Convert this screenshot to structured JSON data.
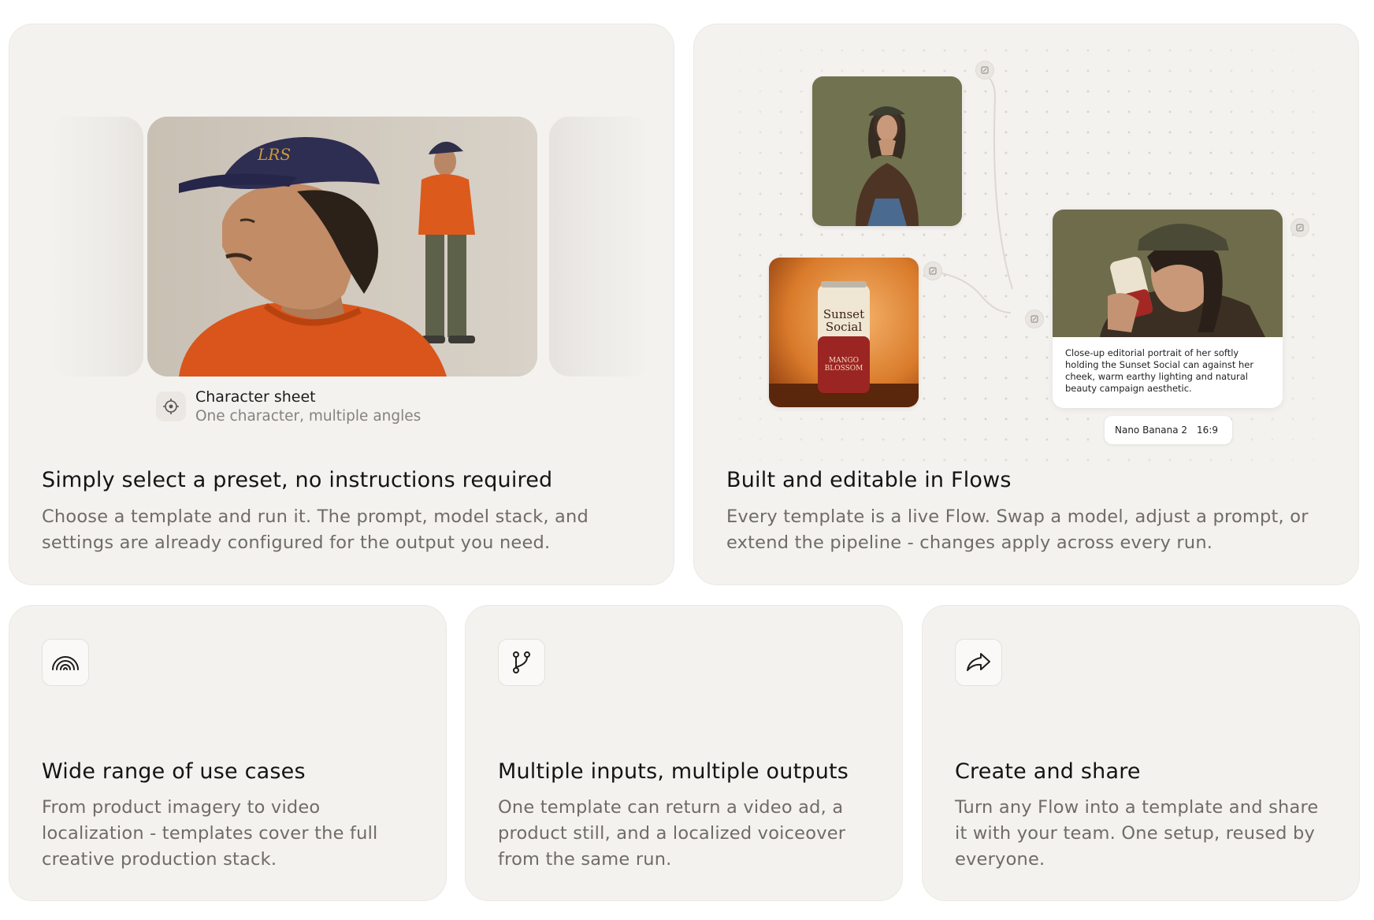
{
  "cards": {
    "presets": {
      "title": "Simply select a preset, no instructions required",
      "description": "Choose a template and run it. The prompt, model stack, and settings are already configured for the output you need.",
      "preset_name": "Character sheet",
      "preset_subtitle": "One character, multiple angles",
      "preset_icon": "character-sheet-icon"
    },
    "flows": {
      "title": "Built and editable in Flows",
      "description": "Every template is a live Flow. Swap a model, adjust a prompt, or extend the pipeline - changes apply across every run.",
      "can_label_top": "Sunset",
      "can_label_bottom": "Social",
      "can_flavor_top": "MANGO",
      "can_flavor_bottom": "BLOSSOM",
      "output_caption": "Close-up editorial portrait of her softly holding the Sunset Social can against her cheek, warm earthy lighting and natural beauty campaign aesthetic.",
      "model_name": "Nano Banana 2",
      "aspect_ratio": "16:9"
    },
    "use_cases": {
      "title": "Wide range of use cases",
      "description": "From product imagery to video localization - templates cover the full creative production stack.",
      "icon": "rainbow-icon"
    },
    "inputs_outputs": {
      "title": "Multiple inputs, multiple outputs",
      "description": "One template can return a video ad, a product still, and a localized voiceover from the same run.",
      "icon": "git-branch-icon"
    },
    "share": {
      "title": "Create and share",
      "description": "Turn any Flow into a template and share it with your team. One setup, reused by everyone.",
      "icon": "share-arrow-icon"
    }
  },
  "colors": {
    "card_background": "#f4f2ef",
    "title_text": "#141414",
    "body_text": "#6f6c68",
    "sweater_orange": "#d9551c"
  }
}
